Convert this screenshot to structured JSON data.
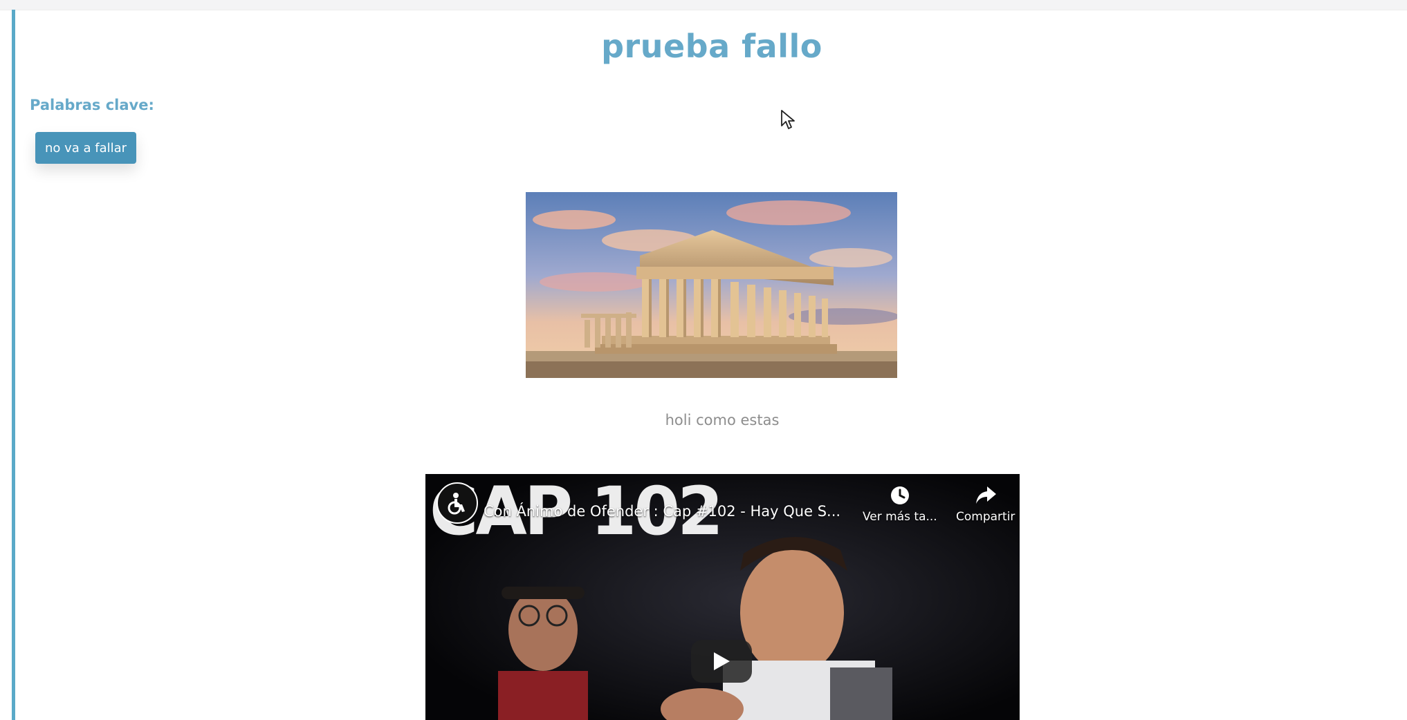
{
  "page": {
    "title": "prueba fallo",
    "keywords_label": "Palabras clave:",
    "keywords": [
      "no va a fallar"
    ],
    "caption": "holi como estas"
  },
  "image": {
    "subject": "parthenon-photo"
  },
  "video": {
    "title": "Con Ánimo de Ofender : Cap #102 - Hay Que S...",
    "thumbnail_text": "CAP 102",
    "watch_later_label": "Ver más ta...",
    "share_label": "Compartir"
  },
  "colors": {
    "accent": "#66a9c9",
    "button": "#4894b9",
    "caption": "#8d8d8d"
  },
  "icons": [
    "channel-avatar-icon",
    "clock-icon",
    "share-icon",
    "play-icon",
    "cursor-icon"
  ]
}
